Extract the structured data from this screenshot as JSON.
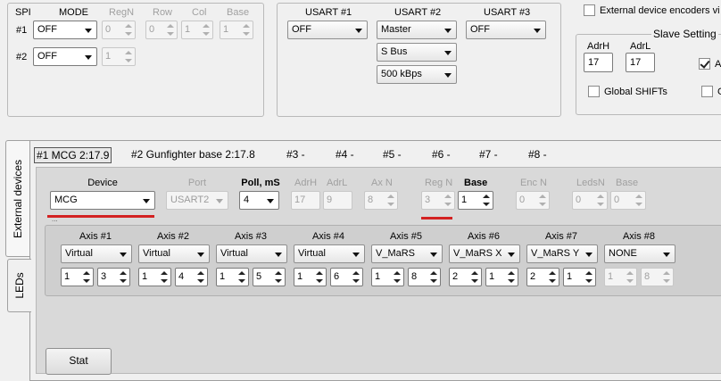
{
  "spi": {
    "col_spi": "SPI",
    "col_mode": "MODE",
    "col_regn": "RegN",
    "col_row": "Row",
    "col_col": "Col",
    "col_base": "Base",
    "rows": [
      {
        "label": "#1",
        "mode": "OFF",
        "regn": "0",
        "row": "0",
        "col": "1",
        "base": "1"
      },
      {
        "label": "#2",
        "mode": "OFF",
        "regn": "1"
      }
    ]
  },
  "usart": {
    "u1_label": "USART #1",
    "u2_label": "USART #2",
    "u3_label": "USART #3",
    "u1_value": "OFF",
    "u2_mode": "Master",
    "u2_bus": "S Bus",
    "u2_speed": "500 kBps",
    "u3_value": "OFF"
  },
  "encoders": {
    "ext_label": "External device encoders vi",
    "slave_title": "Slave Setting",
    "adrh_label": "AdrH",
    "adrl_label": "AdrL",
    "adrh_value": "17",
    "adrl_value": "17",
    "check_a_label": "A",
    "global_shifts_label": "Global SHIFTs",
    "check_g_label": "G"
  },
  "side_tabs": [
    {
      "label": "External devices"
    },
    {
      "label": "LEDs"
    }
  ],
  "device_tabs": [
    {
      "label": "#1 MCG 2:17.9"
    },
    {
      "label": "#2 Gunfighter base 2:17.8"
    },
    {
      "label": "#3 -"
    },
    {
      "label": "#4 -"
    },
    {
      "label": "#5 -"
    },
    {
      "label": "#6 -"
    },
    {
      "label": "#7 -"
    },
    {
      "label": "#8 -"
    }
  ],
  "device_panel": {
    "device_label": "Device",
    "device_value": "MCG",
    "port_label": "Port",
    "port_value": "USART2",
    "poll_label": "Poll, mS",
    "poll_value": "4",
    "adrh_label": "AdrH",
    "adrh_value": "17",
    "adrl_label": "AdrL",
    "adrl_value": "9",
    "axn_label": "Ax N",
    "axn_value": "8",
    "regn_label": "Reg N",
    "regn_value": "3",
    "base_label": "Base",
    "base_value": "1",
    "encn_label": "Enc N",
    "encn_value": "0",
    "ledsn_label": "LedsN",
    "ledsn_value": "0",
    "base2_label": "Base",
    "base2_value": "0"
  },
  "axes": [
    {
      "label": "Axis #1",
      "type": "Virtual",
      "a": "1",
      "b": "3"
    },
    {
      "label": "Axis #2",
      "type": "Virtual",
      "a": "1",
      "b": "4"
    },
    {
      "label": "Axis #3",
      "type": "Virtual",
      "a": "1",
      "b": "5"
    },
    {
      "label": "Axis #4",
      "type": "Virtual",
      "a": "1",
      "b": "6"
    },
    {
      "label": "Axis #5",
      "type": "V_MaRS",
      "a": "1",
      "b": "8"
    },
    {
      "label": "Axis #6",
      "type": "V_MaRS X",
      "a": "2",
      "b": "1"
    },
    {
      "label": "Axis #7",
      "type": "V_MaRS Y",
      "a": "2",
      "b": "1"
    },
    {
      "label": "Axis #8",
      "type": "NONE",
      "a": "1",
      "b": "8"
    }
  ],
  "stat_button": "Stat",
  "colors": {
    "accent_red": "#d32222",
    "panel_bg": "#d9d9d9"
  }
}
